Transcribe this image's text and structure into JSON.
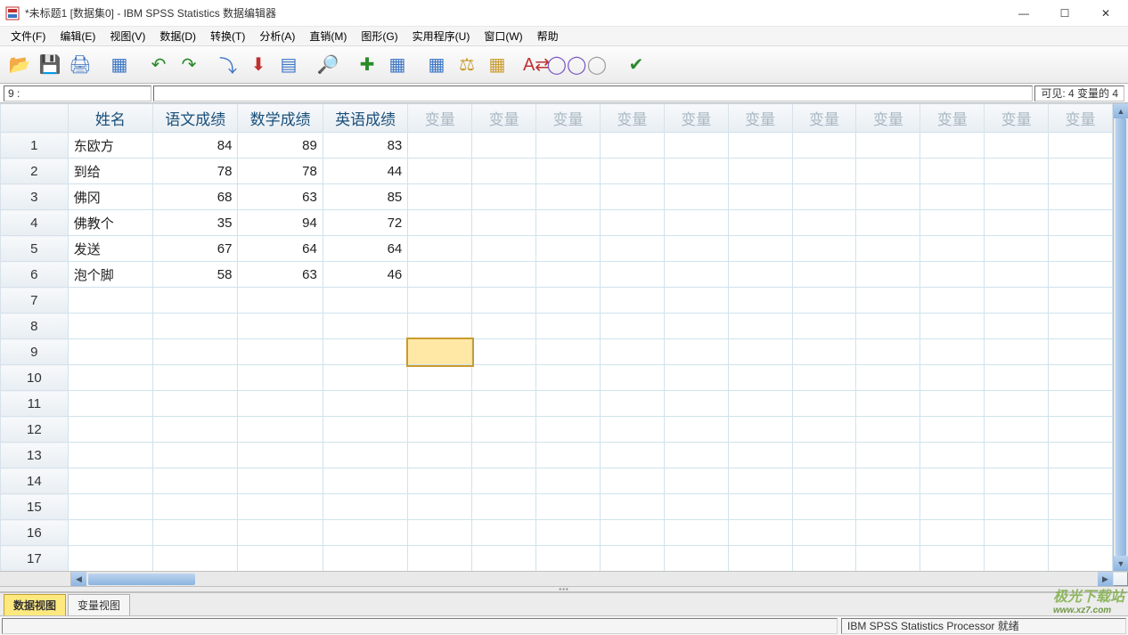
{
  "window": {
    "title": "*未标题1 [数据集0] - IBM SPSS Statistics 数据编辑器",
    "min_icon": "—",
    "max_icon": "☐",
    "close_icon": "✕"
  },
  "menus": [
    "文件(F)",
    "编辑(E)",
    "视图(V)",
    "数据(D)",
    "转换(T)",
    "分析(A)",
    "直销(M)",
    "图形(G)",
    "实用程序(U)",
    "窗口(W)",
    "帮助"
  ],
  "toolbar_icons": [
    {
      "name": "open-icon",
      "glyph": "📂",
      "color": "#e8a23b"
    },
    {
      "name": "save-icon",
      "glyph": "💾",
      "color": "#3b74c4"
    },
    {
      "name": "print-icon",
      "glyph": "🖨",
      "color": "#3b74c4"
    },
    {
      "sep": true
    },
    {
      "name": "recall-icon",
      "glyph": "▦",
      "color": "#3b74c4"
    },
    {
      "sep": true
    },
    {
      "name": "undo-icon",
      "glyph": "↶",
      "color": "#2a8a2a"
    },
    {
      "name": "redo-icon",
      "glyph": "↷",
      "color": "#2a8a2a"
    },
    {
      "sep": true
    },
    {
      "name": "goto-case-icon",
      "glyph": "⤵",
      "color": "#3b74c4"
    },
    {
      "name": "goto-var-icon",
      "glyph": "⬇",
      "color": "#c03030"
    },
    {
      "name": "variables-icon",
      "glyph": "▤",
      "color": "#3b74c4"
    },
    {
      "sep": true
    },
    {
      "name": "find-icon",
      "glyph": "🔎",
      "color": "#555"
    },
    {
      "sep": true
    },
    {
      "name": "insert-case-icon",
      "glyph": "✚",
      "color": "#2a8a2a"
    },
    {
      "name": "split-file-icon",
      "glyph": "▦",
      "color": "#3b74c4"
    },
    {
      "sep": true
    },
    {
      "name": "weight-icon",
      "glyph": "▦",
      "color": "#3b74c4"
    },
    {
      "name": "select-cases-icon",
      "glyph": "⚖",
      "color": "#c89b2e"
    },
    {
      "name": "value-labels-icon",
      "glyph": "▦",
      "color": "#c89b2e"
    },
    {
      "sep": true
    },
    {
      "name": "use-sets-icon",
      "glyph": "A⇄",
      "color": "#c03030"
    },
    {
      "name": "sets-icon",
      "glyph": "◯◯",
      "color": "#7a5bc4"
    },
    {
      "name": "sets2-icon",
      "glyph": "◯",
      "color": "#a0a0a0"
    },
    {
      "sep": true
    },
    {
      "name": "spellcheck-icon",
      "glyph": "✔",
      "color": "#2a8a2a"
    }
  ],
  "cellref": {
    "label": "9 :",
    "visible": "可见:  4 变量的 4"
  },
  "columns": {
    "named": [
      "姓名",
      "语文成绩",
      "数学成绩",
      "英语成绩"
    ],
    "placeholder": "变量",
    "placeholder_count": 11
  },
  "rows": [
    {
      "name": "东欧方",
      "chinese": "84",
      "math": "89",
      "english": "83"
    },
    {
      "name": "到给",
      "chinese": "78",
      "math": "78",
      "english": "44"
    },
    {
      "name": "佛冈",
      "chinese": "68",
      "math": "63",
      "english": "85"
    },
    {
      "name": "佛教个",
      "chinese": "35",
      "math": "94",
      "english": "72"
    },
    {
      "name": "发送",
      "chinese": "67",
      "math": "64",
      "english": "64"
    },
    {
      "name": "泡个脚",
      "chinese": "58",
      "math": "63",
      "english": "46"
    }
  ],
  "total_visible_rows": 17,
  "selected_cell": {
    "row": 9,
    "col": 5
  },
  "tabs": {
    "data": "数据视图",
    "var": "变量视图",
    "active": "data"
  },
  "status": {
    "processor": "IBM SPSS Statistics Processor 就绪"
  },
  "watermark": {
    "main": "极光下载站",
    "sub": "www.xz7.com"
  }
}
